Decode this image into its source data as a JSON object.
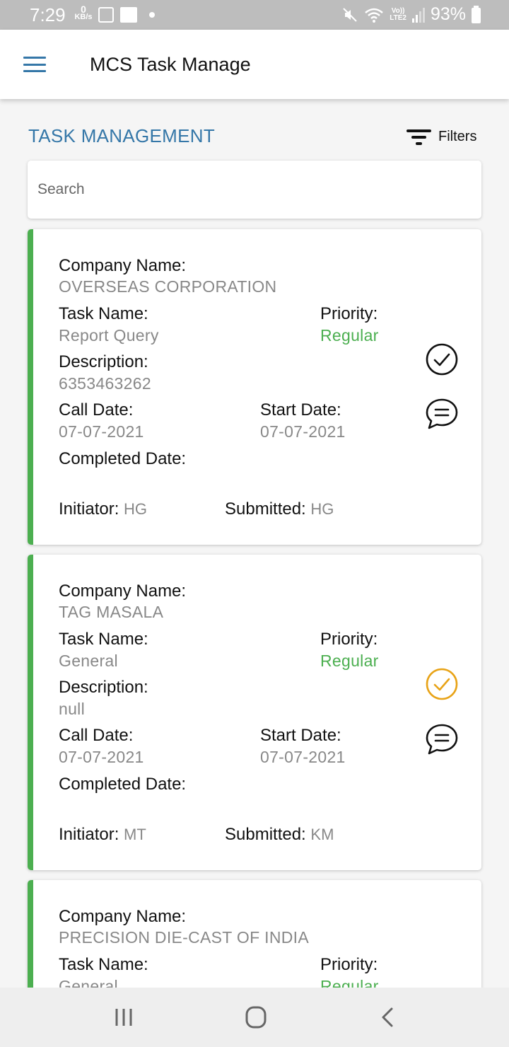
{
  "status_bar": {
    "time": "7:29",
    "net_speed_value": "0",
    "net_speed_unit": "KB/s",
    "volte_label": "Vo))",
    "lte_label": "LTE2",
    "battery": "93%"
  },
  "app_bar": {
    "title": "MCS Task Manage"
  },
  "page": {
    "section_title": "TASK MANAGEMENT",
    "filters_label": "Filters"
  },
  "search": {
    "placeholder": "Search"
  },
  "labels": {
    "company": "Company Name:",
    "task": "Task Name:",
    "priority": "Priority:",
    "description": "Description:",
    "call_date": "Call Date:",
    "start_date": "Start Date:",
    "completed_date": "Completed Date:",
    "initiator": "Initiator:",
    "submitted": "Submitted:"
  },
  "colors": {
    "accent_blue": "#3577a8",
    "card_accent_green": "#4caf50",
    "check_done": "#111111",
    "check_pending": "#e8a317"
  },
  "tasks": [
    {
      "company": "OVERSEAS CORPORATION",
      "task_name": "Report Query",
      "priority": "Regular",
      "description": "6353463262",
      "call_date": "07-07-2021",
      "start_date": "07-07-2021",
      "completed_date": "",
      "initiator": "HG",
      "submitted": "HG",
      "status_icon": "check-circle-icon",
      "status_color": "#111111"
    },
    {
      "company": "TAG MASALA",
      "task_name": "General",
      "priority": "Regular",
      "description": "null",
      "call_date": "07-07-2021",
      "start_date": "07-07-2021",
      "completed_date": "",
      "initiator": "MT",
      "submitted": "KM",
      "status_icon": "check-circle-icon",
      "status_color": "#e8a317"
    },
    {
      "company": "PRECISION DIE-CAST OF INDIA",
      "task_name": "General",
      "priority": "Regular"
    }
  ],
  "nav": {
    "icons": [
      "recent-apps-icon",
      "home-icon",
      "back-icon"
    ]
  }
}
